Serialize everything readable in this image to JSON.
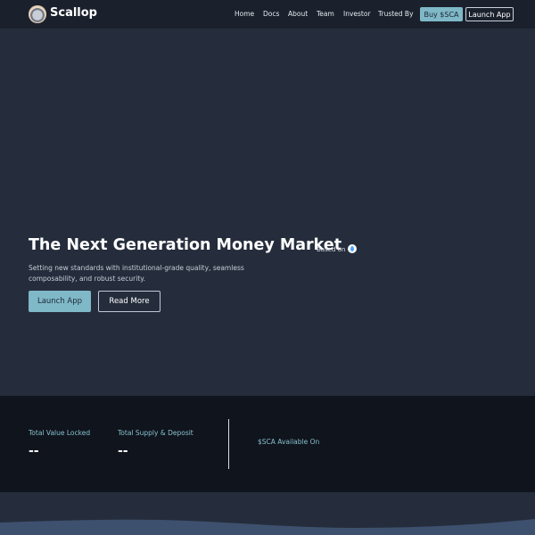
{
  "brand": {
    "name": "Scallop",
    "logo_icon": "scallop-logo-icon"
  },
  "nav": {
    "links": [
      "Home",
      "Docs",
      "About",
      "Team",
      "Investor",
      "Trusted By"
    ],
    "buy_label": "Buy $SCA",
    "launch_label": "Launch App"
  },
  "hero": {
    "title": "The Next Generation Money Market",
    "based_on": "Based on",
    "chain_icon": "sui-chain-icon",
    "subtitle": "Setting new standards with institutional-grade quality, seamless composability, and robust security.",
    "primary_cta": "Launch App",
    "secondary_cta": "Read More"
  },
  "stats": {
    "tvl_label": "Total Value Locked",
    "tvl_value": "--",
    "supply_label": "Total Supply & Deposit",
    "supply_value": "--",
    "available_label": "$SCA Available On"
  },
  "colors": {
    "page_bg": "#252d3c",
    "nav_bg": "#1b212c",
    "accent": "#7fb8c7",
    "stats_bg": "#10141c",
    "stat_label": "#86c0cf"
  }
}
